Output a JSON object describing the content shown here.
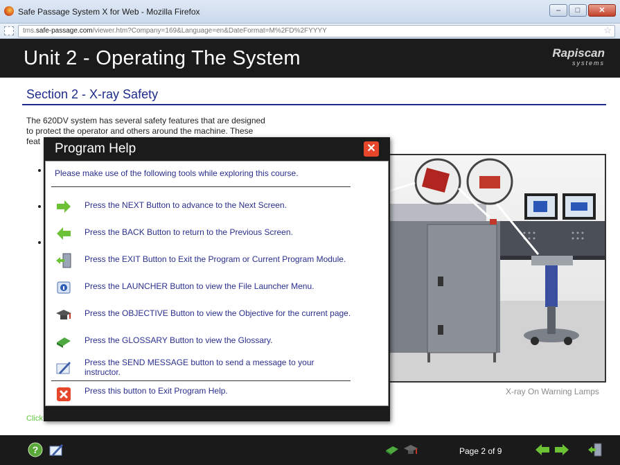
{
  "window": {
    "title": "Safe Passage System X for Web - Mozilla Firefox",
    "url_prefix": "tms.",
    "url_domain": "safe-passage.com",
    "url_path": "/viewer.htm?Company=169&Language=en&DateFormat=M%2FD%2FYYYY",
    "minimize_label": "–",
    "maximize_label": "□",
    "close_label": "✕"
  },
  "header": {
    "unit_title": "Unit 2 - Operating The System",
    "logo_main": "Rapiscan",
    "logo_sub": "systems"
  },
  "content": {
    "section_title": "Section 2 - X-ray Safety",
    "body_line1": "The 620DV system has several safety features that are designed",
    "body_line2": "to protect the operator and others around the machine. These",
    "body_line3": "feat",
    "image_caption": "X-ray On Warning Lamps",
    "click_next": "Click NEXT to continue."
  },
  "footer": {
    "page_indicator": "Page 2 of 9"
  },
  "modal": {
    "title": "Program Help",
    "intro": "Please make use of the following tools while exploring this course.",
    "items": [
      {
        "icon": "next-arrow-icon",
        "text": "Press the NEXT Button to advance to the Next Screen."
      },
      {
        "icon": "back-arrow-icon",
        "text": "Press the BACK Button to return to the Previous Screen."
      },
      {
        "icon": "exit-door-icon",
        "text": "Press the EXIT Button to Exit the Program or Current Program Module."
      },
      {
        "icon": "launcher-icon",
        "text": "Press the LAUNCHER Button to view the File Launcher Menu."
      },
      {
        "icon": "graduation-cap-icon",
        "text": "Press the OBJECTIVE Button to view the Objective for the current page."
      },
      {
        "icon": "glossary-book-icon",
        "text": "Press the GLOSSARY Button to view the Glossary."
      },
      {
        "icon": "send-message-icon",
        "text": "Press the SEND MESSAGE button to send a message to your instructor."
      },
      {
        "icon": "close-help-icon",
        "text": "Press this button to Exit Program Help."
      }
    ]
  },
  "colors": {
    "heading_blue": "#1e2b8c",
    "help_text_blue": "#2a2f8c",
    "arrow_green": "#6cc234",
    "close_red": "#e6472b",
    "bar_black": "#1b1b1b"
  }
}
